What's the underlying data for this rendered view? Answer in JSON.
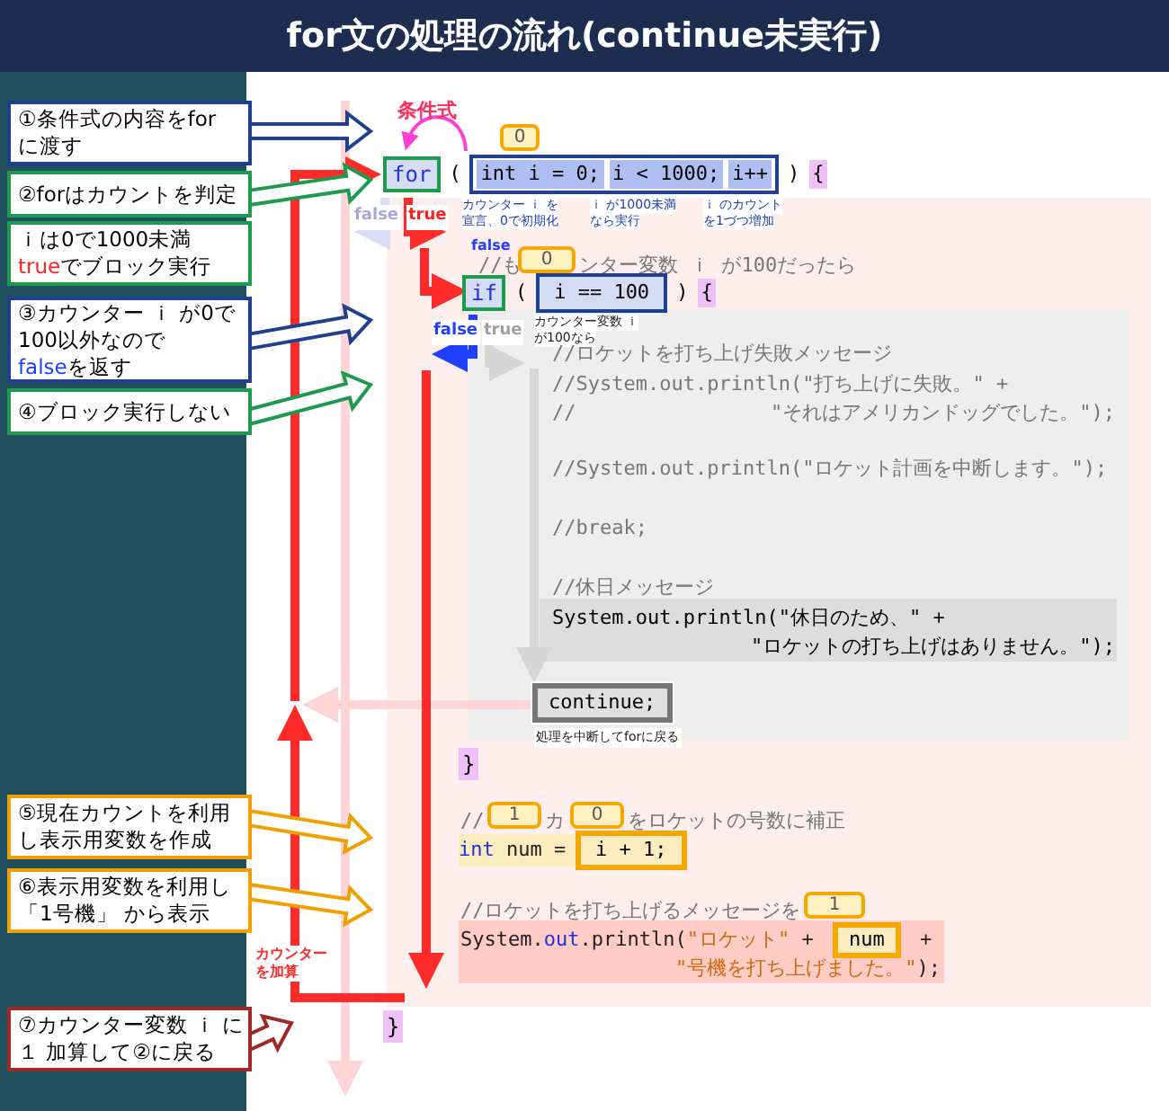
{
  "title": "for文の処理の流れ(continue未実行)",
  "callouts": [
    {
      "color": "#1f3f8f",
      "lines": [
        [
          {
            "kind": "plain",
            "text": "①条件式の内容をfor"
          }
        ],
        [
          {
            "kind": "plain",
            "text": "に渡す"
          }
        ]
      ]
    },
    {
      "color": "#1e9a4e",
      "lines": [
        [
          {
            "kind": "plain",
            "text": "②forはカウントを判定"
          }
        ]
      ]
    },
    {
      "color": "#1e9a4e",
      "lines": [
        [
          {
            "kind": "plain",
            "text": "ｉは0で1000未満"
          }
        ],
        [
          {
            "kind": "true",
            "text": "true"
          },
          {
            "kind": "plain",
            "text": "でブロック実行"
          }
        ]
      ]
    },
    {
      "color": "#1f3f8f",
      "lines": [
        [
          {
            "kind": "plain",
            "text": "③カウンター ｉ が0で"
          }
        ],
        [
          {
            "kind": "plain",
            "text": "100以外なので"
          }
        ],
        [
          {
            "kind": "false",
            "text": "false"
          },
          {
            "kind": "plain",
            "text": "を返す"
          }
        ]
      ]
    },
    {
      "color": "#1e9a4e",
      "lines": [
        [
          {
            "kind": "plain",
            "text": "④ブロック実行しない"
          }
        ]
      ]
    },
    {
      "color": "#f0a000",
      "lines": [
        [
          {
            "kind": "plain",
            "text": "⑤現在カウントを利用"
          }
        ],
        [
          {
            "kind": "plain",
            "text": "し表示用変数を作成"
          }
        ]
      ]
    },
    {
      "color": "#f0a000",
      "lines": [
        [
          {
            "kind": "plain",
            "text": "⑥表示用変数を利用し"
          }
        ],
        [
          {
            "kind": "plain",
            "text": "「1号機」 から表示"
          }
        ]
      ]
    },
    {
      "color": "#a02828",
      "lines": [
        [
          {
            "kind": "plain",
            "text": "⑦カウンター変数 ｉ に"
          }
        ],
        [
          {
            "kind": "plain",
            "text": "１ 加算して②に戻る"
          }
        ]
      ]
    }
  ],
  "for_statement": {
    "condition_label": "条件式",
    "value_bubble": "0",
    "keyword": "for",
    "open_paren": "(",
    "init": "int i = 0;",
    "condition": "i < 1000;",
    "update": "i++",
    "close_paren": ")",
    "brace": "{",
    "notes": [
      [
        "カウンター ｉ を",
        "宣言、0で初期化"
      ],
      [
        "ｉ が1000未満",
        "なら実行"
      ],
      [
        "ｉ のカウント",
        "を1づつ増加"
      ]
    ],
    "branches": [
      {
        "text": "false",
        "selected": false
      },
      {
        "text": "true",
        "selected": true
      }
    ]
  },
  "if_statement": {
    "false_hint": "false",
    "comment_parts": [
      "//も",
      "ンター変数 ｉ が100だったら"
    ],
    "value_bubble": "0",
    "keyword": "if",
    "open_paren": "(",
    "condition": "i == 100",
    "close_paren": ")",
    "brace": "{",
    "note": [
      "カウンター変数 ｉ",
      "が100なら"
    ],
    "branches": [
      {
        "text": "false",
        "selected": true
      },
      {
        "text": "true",
        "selected": false
      }
    ]
  },
  "if_block": {
    "lines": [
      [
        "//ロケットを打ち上げ失敗メッセージ"
      ],
      [
        "//System.out.println(\"打ち上げに失敗。\" +"
      ],
      [
        "//",
        "\"それはアメリカンドッグでした。\");"
      ],
      [
        "//System.out.println(\"ロケット計画を中断します。\");"
      ],
      [
        "//break;"
      ],
      [
        "//休日メッセージ"
      ]
    ],
    "active_lines": [
      "System.out.println(\"休日のため、\" +",
      "\"ロケットの打ち上げはありません。\");"
    ],
    "continue": "continue;",
    "continue_note": "処理を中断してforに戻る",
    "closing_brace": "}"
  },
  "numbering": {
    "comment_parts": [
      "//",
      "カ",
      "をロケットの号数に補正"
    ],
    "bubbles": [
      "1",
      "0"
    ],
    "declaration": [
      {
        "kind": "keyword",
        "text": "int"
      },
      {
        "kind": "plain",
        "text": " num = "
      }
    ],
    "expression": "i + 1;"
  },
  "message": {
    "comment": "//ロケットを打ち上げるメッセージを",
    "bubble": "1",
    "first_line": [
      {
        "kind": "plain",
        "text": "System."
      },
      {
        "kind": "field",
        "text": "out"
      },
      {
        "kind": "plain",
        "text": ".println("
      },
      {
        "kind": "string",
        "text": "\"ロケット\""
      },
      {
        "kind": "plain",
        "text": " + "
      },
      {
        "kind": "var",
        "text": "num"
      },
      {
        "kind": "plain",
        "text": " +"
      }
    ],
    "second_line": [
      {
        "kind": "string",
        "text": "\"号機を打ち上げました。\""
      },
      {
        "kind": "plain",
        "text": ");"
      }
    ]
  },
  "counter_label": [
    "カウンター",
    "を加算"
  ],
  "closing_brace": "}"
}
